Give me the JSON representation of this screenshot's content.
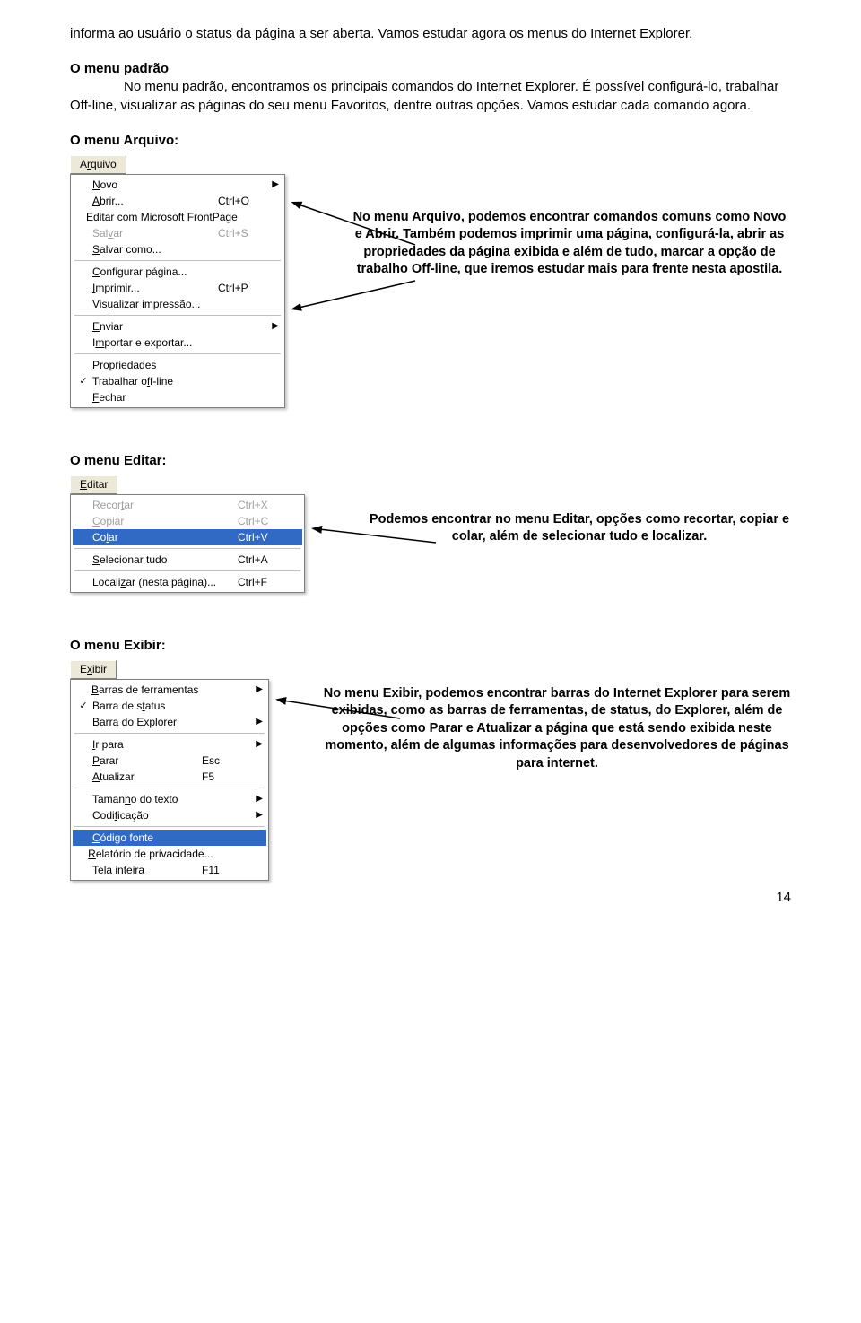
{
  "intro": "informa ao usuário o status da página a ser aberta. Vamos estudar agora os menus do Internet Explorer.",
  "padrao": {
    "title": "O menu padrão",
    "text": "No menu padrão, encontramos os principais comandos do Internet Explorer. É possível configurá-lo, trabalhar Off-line, visualizar as páginas do seu menu Favoritos, dentre outras opções. Vamos estudar cada comando agora."
  },
  "arquivo": {
    "title": "O menu Arquivo:",
    "menu_title_pre": "A",
    "menu_title_ul": "r",
    "menu_title_post": "quivo",
    "items": [
      {
        "pre": "",
        "ul": "N",
        "post": "ovo",
        "shortcut": "",
        "arrow": "▶",
        "check": ""
      },
      {
        "pre": "",
        "ul": "A",
        "post": "brir...",
        "shortcut": "Ctrl+O",
        "arrow": "",
        "check": ""
      },
      {
        "pre": "Ed",
        "ul": "i",
        "post": "tar com Microsoft FrontPage",
        "shortcut": "",
        "arrow": "",
        "check": ""
      },
      {
        "pre": "Sal",
        "ul": "v",
        "post": "ar",
        "shortcut": "Ctrl+S",
        "arrow": "",
        "check": "",
        "disabled": true
      },
      {
        "pre": "",
        "ul": "S",
        "post": "alvar como...",
        "shortcut": "",
        "arrow": "",
        "check": ""
      },
      {
        "sep": true
      },
      {
        "pre": "",
        "ul": "C",
        "post": "onfigurar página...",
        "shortcut": "",
        "arrow": "",
        "check": ""
      },
      {
        "pre": "",
        "ul": "I",
        "post": "mprimir...",
        "shortcut": "Ctrl+P",
        "arrow": "",
        "check": ""
      },
      {
        "pre": "Vis",
        "ul": "u",
        "post": "alizar impressão...",
        "shortcut": "",
        "arrow": "",
        "check": ""
      },
      {
        "sep": true
      },
      {
        "pre": "",
        "ul": "E",
        "post": "nviar",
        "shortcut": "",
        "arrow": "▶",
        "check": ""
      },
      {
        "pre": "I",
        "ul": "m",
        "post": "portar e exportar...",
        "shortcut": "",
        "arrow": "",
        "check": ""
      },
      {
        "sep": true
      },
      {
        "pre": "",
        "ul": "P",
        "post": "ropriedades",
        "shortcut": "",
        "arrow": "",
        "check": ""
      },
      {
        "pre": "Trabalhar o",
        "ul": "f",
        "post": "f-line",
        "shortcut": "",
        "arrow": "",
        "check": "✓"
      },
      {
        "pre": "",
        "ul": "F",
        "post": "echar",
        "shortcut": "",
        "arrow": "",
        "check": ""
      }
    ],
    "desc": "No menu Arquivo, podemos encontrar comandos comuns como Novo e Abrir. Também podemos imprimir uma página, configurá-la, abrir as propriedades da página exibida e além de tudo, marcar a opção de trabalho Off-line, que iremos estudar mais para frente nesta apostila."
  },
  "editar": {
    "title": "O menu Editar:",
    "menu_title_pre": "",
    "menu_title_ul": "E",
    "menu_title_post": "ditar",
    "items": [
      {
        "pre": "Recor",
        "ul": "t",
        "post": "ar",
        "shortcut": "Ctrl+X",
        "arrow": "",
        "check": "",
        "disabled": true
      },
      {
        "pre": "",
        "ul": "C",
        "post": "opiar",
        "shortcut": "Ctrl+C",
        "arrow": "",
        "check": "",
        "disabled": true
      },
      {
        "pre": "Co",
        "ul": "l",
        "post": "ar",
        "shortcut": "Ctrl+V",
        "arrow": "",
        "check": "",
        "highlight": true
      },
      {
        "sep": true
      },
      {
        "pre": "",
        "ul": "S",
        "post": "elecionar tudo",
        "shortcut": "Ctrl+A",
        "arrow": "",
        "check": ""
      },
      {
        "sep": true
      },
      {
        "pre": "Locali",
        "ul": "z",
        "post": "ar (nesta página)...",
        "shortcut": "Ctrl+F",
        "arrow": "",
        "check": ""
      }
    ],
    "desc": "Podemos encontrar no menu Editar, opções como recortar, copiar e colar, além de selecionar tudo e localizar."
  },
  "exibir": {
    "title": "O menu Exibir:",
    "menu_title_pre": "E",
    "menu_title_ul": "x",
    "menu_title_post": "ibir",
    "items": [
      {
        "pre": "",
        "ul": "B",
        "post": "arras de ferramentas",
        "shortcut": "",
        "arrow": "▶",
        "check": ""
      },
      {
        "pre": "Barra de s",
        "ul": "t",
        "post": "atus",
        "shortcut": "",
        "arrow": "",
        "check": "✓"
      },
      {
        "pre": "Barra do ",
        "ul": "E",
        "post": "xplorer",
        "shortcut": "",
        "arrow": "▶",
        "check": ""
      },
      {
        "sep": true
      },
      {
        "pre": "",
        "ul": "I",
        "post": "r para",
        "shortcut": "",
        "arrow": "▶",
        "check": ""
      },
      {
        "pre": "",
        "ul": "P",
        "post": "arar",
        "shortcut": "Esc",
        "arrow": "",
        "check": ""
      },
      {
        "pre": "",
        "ul": "A",
        "post": "tualizar",
        "shortcut": "F5",
        "arrow": "",
        "check": ""
      },
      {
        "sep": true
      },
      {
        "pre": "Taman",
        "ul": "h",
        "post": "o do texto",
        "shortcut": "",
        "arrow": "▶",
        "check": ""
      },
      {
        "pre": "Codi",
        "ul": "f",
        "post": "icação",
        "shortcut": "",
        "arrow": "▶",
        "check": ""
      },
      {
        "sep": true
      },
      {
        "pre": "",
        "ul": "C",
        "post": "ódigo fonte",
        "shortcut": "",
        "arrow": "",
        "check": "",
        "highlight": true
      },
      {
        "pre": "",
        "ul": "R",
        "post": "elatório de privacidade...",
        "shortcut": "",
        "arrow": "",
        "check": ""
      },
      {
        "pre": "Te",
        "ul": "l",
        "post": "a inteira",
        "shortcut": "F11",
        "arrow": "",
        "check": ""
      }
    ],
    "desc": "No menu Exibir, podemos encontrar barras do Internet Explorer para serem exibidas, como as barras de ferramentas, de status, do Explorer, além de opções como Parar e Atualizar a página que está sendo exibida neste momento, além de algumas informações para desenvolvedores de páginas para internet."
  },
  "page_number": "14"
}
